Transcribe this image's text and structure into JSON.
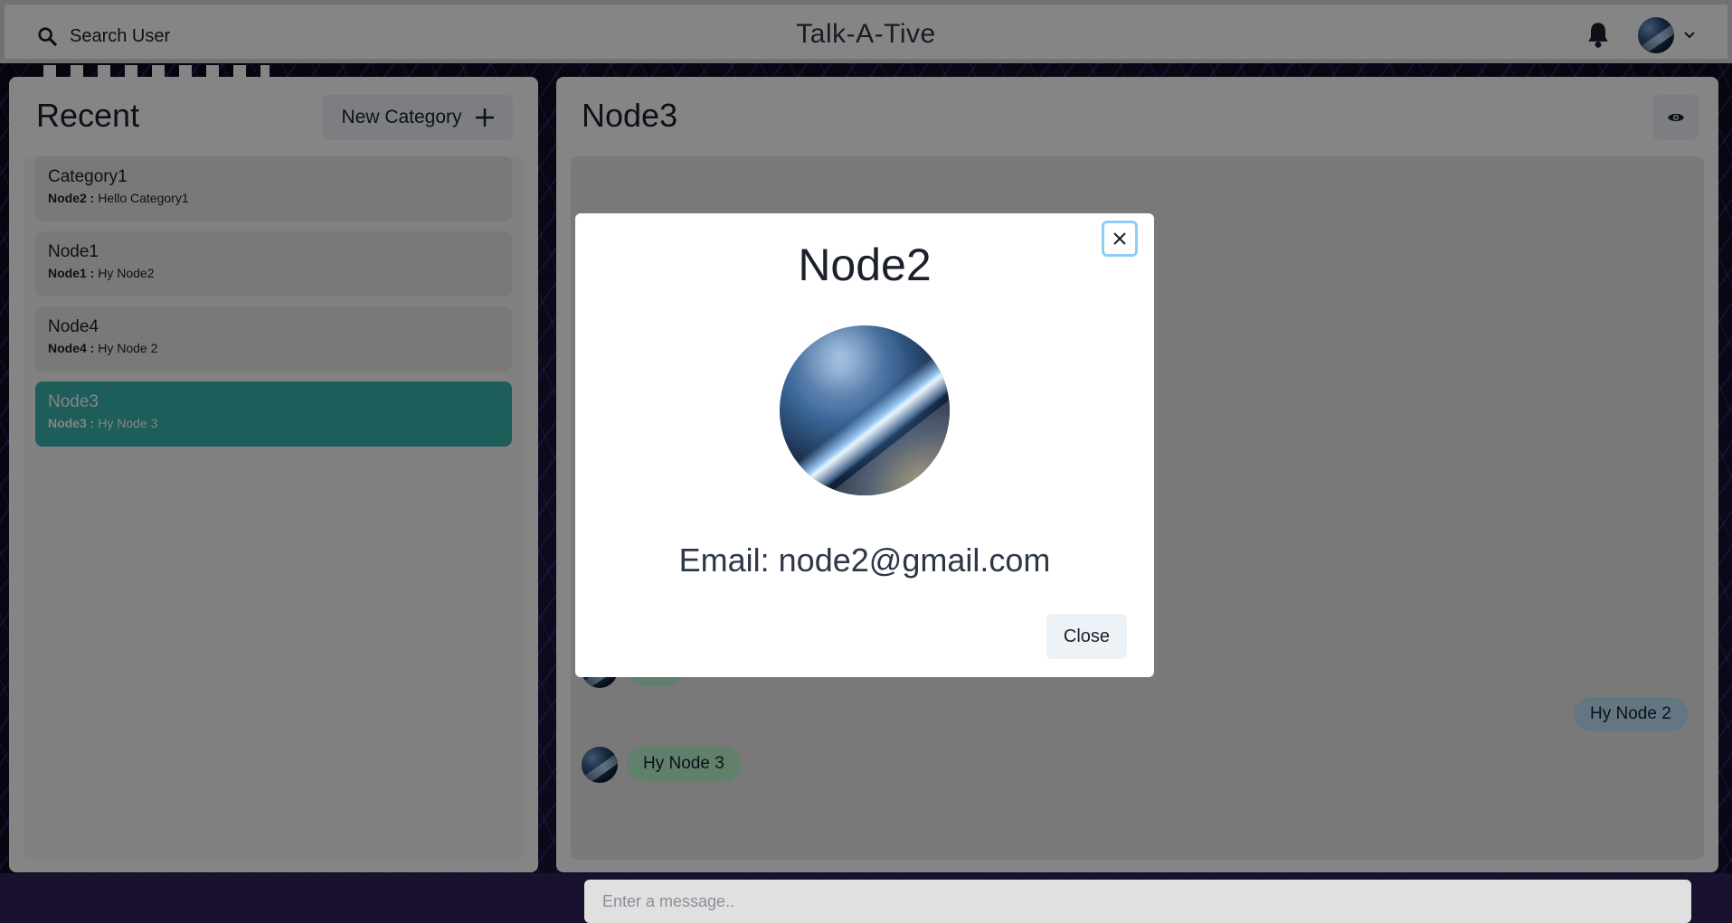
{
  "header": {
    "search_label": "Search User",
    "app_title": "Talk-A-Tive"
  },
  "sidebar": {
    "title": "Recent",
    "new_category_label": "New Category",
    "chats": [
      {
        "name": "Category1",
        "sender": "Node2 :",
        "message": "Hello Category1",
        "active": false
      },
      {
        "name": "Node1",
        "sender": "Node1 :",
        "message": "Hy Node2",
        "active": false
      },
      {
        "name": "Node4",
        "sender": "Node4 :",
        "message": "Hy Node 2",
        "active": false
      },
      {
        "name": "Node3",
        "sender": "Node3 :",
        "message": "Hy Node 3",
        "active": true
      }
    ]
  },
  "chat": {
    "title": "Node3",
    "messages": [
      {
        "text": "Hy Node 2",
        "mine": true
      },
      {
        "text": "Hy Node 3",
        "mine": false
      }
    ],
    "input_placeholder": "Enter a message.."
  },
  "modal": {
    "title": "Node2",
    "email": "Email: node2@gmail.com",
    "close_label": "Close"
  },
  "colors": {
    "active_chat": "#38b2ac",
    "their_bubble": "#b9f5d0",
    "my_bubble": "#bee3f8"
  },
  "icons": {
    "search": "search-icon",
    "bell": "bell-icon",
    "chevron": "chevron-down-icon",
    "plus": "plus-icon",
    "eye": "eye-icon",
    "close": "close-icon"
  }
}
